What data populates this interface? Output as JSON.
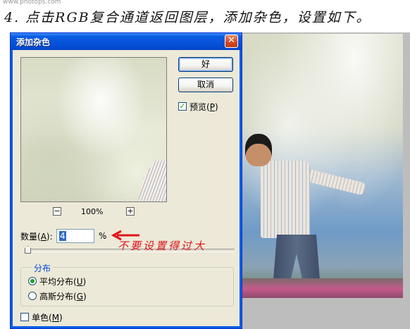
{
  "page": {
    "watermark": "www.photops.com",
    "caption": "4. 点击RGB复合通道返回图层，添加杂色，设置如下。"
  },
  "dialog": {
    "title": "添加杂色",
    "close_glyph": "✕",
    "ok_label": "好",
    "cancel_label": "取消",
    "preview_checkbox": {
      "label_main": "预览(",
      "label_key": "P",
      "label_end": ")",
      "checked": true,
      "check_glyph": "✓"
    },
    "zoom": {
      "minus": "−",
      "plus": "+",
      "value": "100%"
    },
    "amount": {
      "label_main": "数量(",
      "label_key": "A",
      "label_end": "):",
      "value": "4",
      "unit": "%"
    },
    "distribution": {
      "legend": "分布",
      "options": [
        {
          "label_main": "平均分布(",
          "label_key": "U",
          "label_end": ")",
          "selected": true
        },
        {
          "label_main": "高斯分布(",
          "label_key": "G",
          "label_end": ")",
          "selected": false
        }
      ]
    },
    "monochrome": {
      "label_main": "单色(",
      "label_key": "M",
      "label_end": ")",
      "checked": false
    }
  },
  "annotation": {
    "text": "不要设置得过大",
    "color": "#e0141b"
  },
  "colors": {
    "titlebar": "#0a5de4",
    "dialog_bg": "#ece9d8",
    "check": "#21a121"
  }
}
